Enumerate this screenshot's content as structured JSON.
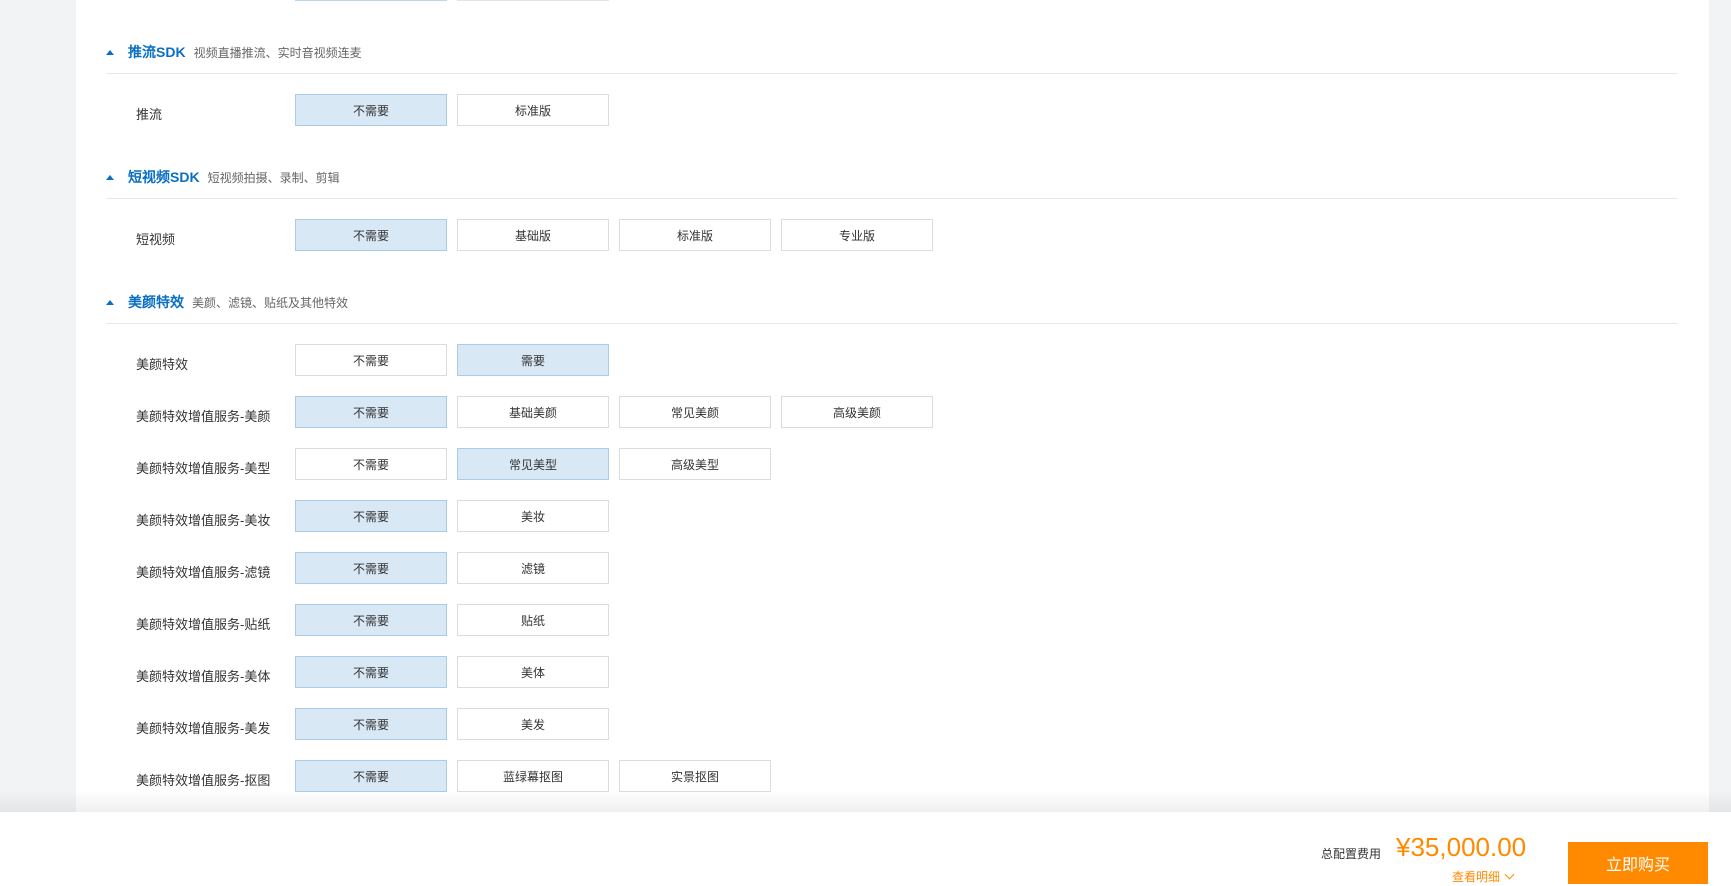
{
  "sections": {
    "push": {
      "title": "推流SDK",
      "desc": "视频直播推流、实时音视频连麦",
      "rows": [
        {
          "label": "推流",
          "options": [
            "不需要",
            "标准版"
          ],
          "selected": 0
        }
      ]
    },
    "shortvideo": {
      "title": "短视频SDK",
      "desc": "短视频拍摄、录制、剪辑",
      "rows": [
        {
          "label": "短视频",
          "options": [
            "不需要",
            "基础版",
            "标准版",
            "专业版"
          ],
          "selected": 0
        }
      ]
    },
    "beauty": {
      "title": "美颜特效",
      "desc": "美颜、滤镜、贴纸及其他特效",
      "rows": [
        {
          "label": "美颜特效",
          "options": [
            "不需要",
            "需要"
          ],
          "selected": 1
        },
        {
          "label": "美颜特效增值服务-美颜",
          "options": [
            "不需要",
            "基础美颜",
            "常见美颜",
            "高级美颜"
          ],
          "selected": 0
        },
        {
          "label": "美颜特效增值服务-美型",
          "options": [
            "不需要",
            "常见美型",
            "高级美型"
          ],
          "selected": 1
        },
        {
          "label": "美颜特效增值服务-美妆",
          "options": [
            "不需要",
            "美妆"
          ],
          "selected": 0
        },
        {
          "label": "美颜特效增值服务-滤镜",
          "options": [
            "不需要",
            "滤镜"
          ],
          "selected": 0
        },
        {
          "label": "美颜特效增值服务-贴纸",
          "options": [
            "不需要",
            "贴纸"
          ],
          "selected": 0
        },
        {
          "label": "美颜特效增值服务-美体",
          "options": [
            "不需要",
            "美体"
          ],
          "selected": 0
        },
        {
          "label": "美颜特效增值服务-美发",
          "options": [
            "不需要",
            "美发"
          ],
          "selected": 0
        },
        {
          "label": "美颜特效增值服务-抠图",
          "options": [
            "不需要",
            "蓝绿幕抠图",
            "实景抠图"
          ],
          "selected": 0
        }
      ]
    }
  },
  "footer": {
    "total_label": "总配置费用",
    "total_price": "¥35,000.00",
    "details_label": "查看明细",
    "buy_label": "立即购买"
  },
  "colors": {
    "accent_blue": "#0a6fc4",
    "selected_bg": "#d8e8f5",
    "price_orange": "#ff8a00"
  }
}
